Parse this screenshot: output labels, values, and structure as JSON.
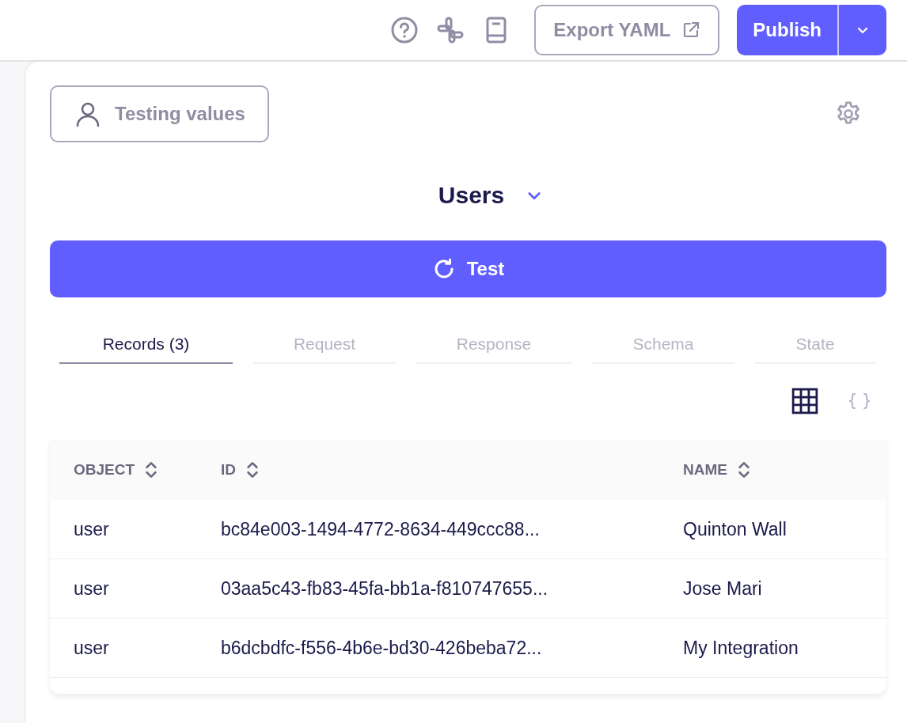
{
  "header": {
    "export_button": "Export YAML",
    "publish_button": "Publish"
  },
  "panel": {
    "testing_values_button": "Testing values",
    "stream_title": "Users",
    "test_button": "Test"
  },
  "tabs": [
    {
      "label": "Records (3)",
      "selected": true
    },
    {
      "label": "Request",
      "selected": false
    },
    {
      "label": "Response",
      "selected": false
    },
    {
      "label": "Schema",
      "selected": false
    },
    {
      "label": "State",
      "selected": false
    }
  ],
  "view_toggles": [
    {
      "kind": "table",
      "selected": true
    },
    {
      "kind": "json",
      "selected": false
    }
  ],
  "table": {
    "columns": [
      "OBJECT",
      "ID",
      "NAME"
    ],
    "rows": [
      [
        "user",
        "bc84e003-1494-4772-8634-449ccc88...",
        "Quinton Wall"
      ],
      [
        "user",
        "03aa5c43-fb83-45fa-bb1a-f810747655...",
        "Jose Mari"
      ],
      [
        "user",
        "b6dcbdfc-f556-4b6e-bd30-426beba72...",
        "My Integration"
      ]
    ]
  }
}
